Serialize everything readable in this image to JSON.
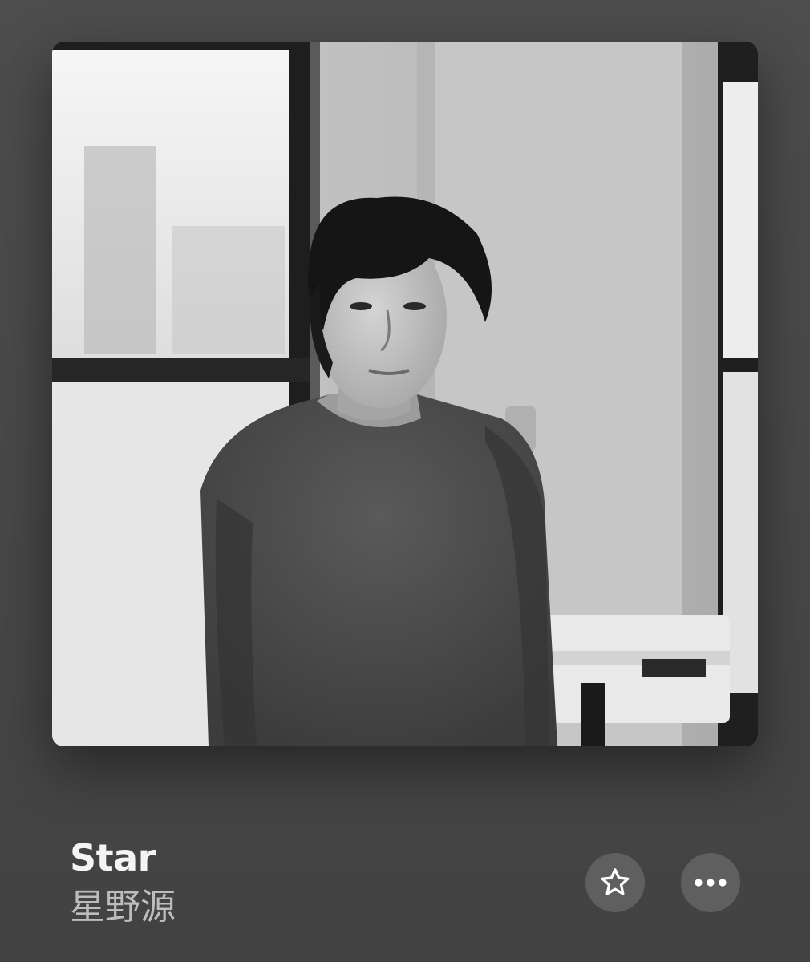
{
  "now_playing": {
    "title": "Star",
    "artist": "星野源"
  },
  "controls": {
    "favorite_icon": "star-outline-icon",
    "more_icon": "ellipsis-icon"
  },
  "colors": {
    "background": "#4a4a4a",
    "title": "#f4f4f4",
    "artist": "#bdbdbd",
    "button_bg": "#5f5f5f",
    "button_icon": "#ffffff"
  }
}
